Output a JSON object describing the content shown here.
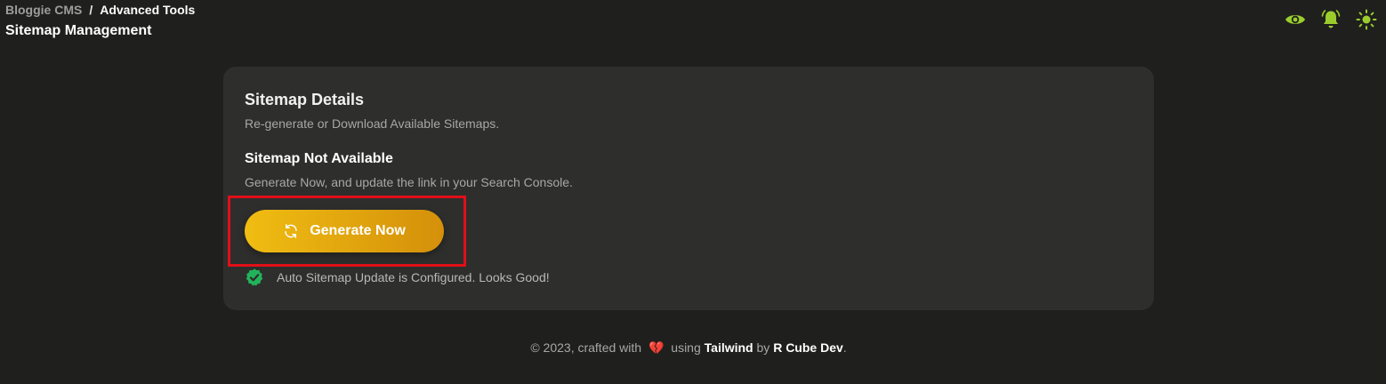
{
  "header": {
    "breadcrumb_root": "Bloggie CMS",
    "breadcrumb_sep": "/",
    "breadcrumb_current": "Advanced Tools",
    "page_title": "Sitemap Management",
    "icons": [
      "eye-icon",
      "bell-icon",
      "sun-icon"
    ],
    "icon_color": "#9acd2c"
  },
  "card": {
    "title": "Sitemap Details",
    "subtitle": "Re-generate or Download Available Sitemaps.",
    "status_title": "Sitemap Not Available",
    "status_subtitle": "Generate Now, and update the link in your Search Console.",
    "generate_button_label": "Generate Now",
    "auto_status_text": "Auto Sitemap Update is Configured. Looks Good!"
  },
  "footer": {
    "prefix": "© 2023, crafted with",
    "heart": "💔",
    "using": "using",
    "framework": "Tailwind",
    "by": "by",
    "author": "R Cube Dev",
    "suffix": "."
  },
  "colors": {
    "background": "#1f1f1e",
    "card": "#2e2e2d",
    "accent_green": "#9acd2c",
    "button_gradient_start": "#f0bd12",
    "button_gradient_end": "#d4900a",
    "highlight_border": "#e10f18",
    "check_green": "#22b35a"
  }
}
